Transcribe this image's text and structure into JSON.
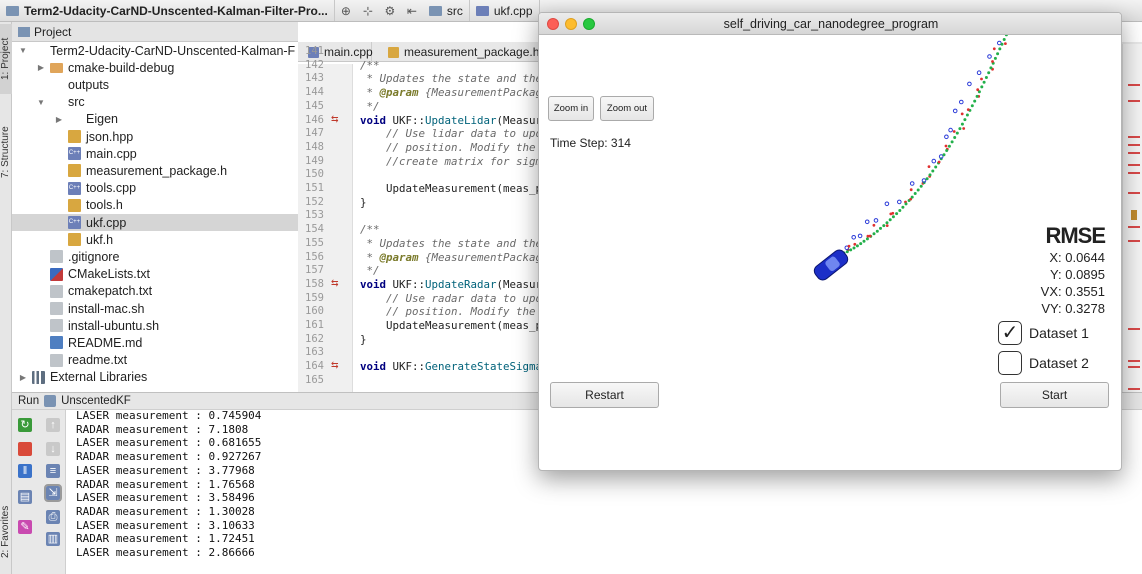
{
  "topbar": {
    "project_root": "Term2-Udacity-CarND-Unscented-Kalman-Filter-Pro...",
    "crumb_src": "src",
    "crumb_file": "ukf.cpp"
  },
  "side_tabs": {
    "project": "1: Project",
    "structure": "7: Structure",
    "favorites": "2: Favorites"
  },
  "project_panel": {
    "title": "Project",
    "items": [
      {
        "label": "Term2-Udacity-CarND-Unscented-Kalman-F",
        "kind": "folder",
        "twisty": "▼"
      },
      {
        "label": "cmake-build-debug",
        "kind": "foldo",
        "twisty": "▶"
      },
      {
        "label": "outputs",
        "kind": "folder",
        "twisty": ""
      },
      {
        "label": "src",
        "kind": "folder",
        "twisty": "▼"
      },
      {
        "label": "Eigen",
        "kind": "folder",
        "twisty": "▶"
      },
      {
        "label": "json.hpp",
        "kind": "h",
        "twisty": ""
      },
      {
        "label": "main.cpp",
        "kind": "cpp",
        "twisty": ""
      },
      {
        "label": "measurement_package.h",
        "kind": "h",
        "twisty": ""
      },
      {
        "label": "tools.cpp",
        "kind": "cpp",
        "twisty": ""
      },
      {
        "label": "tools.h",
        "kind": "h",
        "twisty": ""
      },
      {
        "label": "ukf.cpp",
        "kind": "cpp",
        "twisty": "",
        "selected": true
      },
      {
        "label": "ukf.h",
        "kind": "h",
        "twisty": ""
      },
      {
        "label": ".gitignore",
        "kind": "txt",
        "twisty": ""
      },
      {
        "label": "CMakeLists.txt",
        "kind": "cm",
        "twisty": ""
      },
      {
        "label": "cmakepatch.txt",
        "kind": "txt",
        "twisty": ""
      },
      {
        "label": "install-mac.sh",
        "kind": "txt",
        "twisty": ""
      },
      {
        "label": "install-ubuntu.sh",
        "kind": "txt",
        "twisty": ""
      },
      {
        "label": "README.md",
        "kind": "md",
        "twisty": ""
      },
      {
        "label": "readme.txt",
        "kind": "txt",
        "twisty": ""
      },
      {
        "label": "External Libraries",
        "kind": "lib",
        "twisty": "▶"
      }
    ]
  },
  "editor": {
    "tabs": [
      "main.cpp",
      "measurement_package.h"
    ],
    "lines": [
      {
        "n": "141",
        "html": ""
      },
      {
        "n": "142",
        "html": "<span>/**</span>",
        "c": true
      },
      {
        "n": "143",
        "html": " * Updates the state and the",
        "c": true
      },
      {
        "n": "144",
        "html": " * <span class=\"tg\">@param</span> {MeasurementPackage",
        "c": true
      },
      {
        "n": "145",
        "html": " */",
        "c": true
      },
      {
        "n": "146",
        "html": "<span class=\"kw\">void</span> UKF::<span class=\"fn\">UpdateLidar</span>(Measur",
        "g": true
      },
      {
        "n": "147",
        "html": "    // Use lidar data to upd",
        "c": true
      },
      {
        "n": "148",
        "html": "    // position. Modify the",
        "c": true
      },
      {
        "n": "149",
        "html": "    //create matrix for sigm",
        "c": true
      },
      {
        "n": "150",
        "html": ""
      },
      {
        "n": "151",
        "html": "    UpdateMeasurement(meas_p"
      },
      {
        "n": "152",
        "html": "}"
      },
      {
        "n": "153",
        "html": ""
      },
      {
        "n": "154",
        "html": "/**",
        "c": true
      },
      {
        "n": "155",
        "html": " * Updates the state and the",
        "c": true
      },
      {
        "n": "156",
        "html": " * <span class=\"tg\">@param</span> {MeasurementPackage",
        "c": true
      },
      {
        "n": "157",
        "html": " */",
        "c": true
      },
      {
        "n": "158",
        "html": "<span class=\"kw\">void</span> UKF::<span class=\"fn\">UpdateRadar</span>(Measur",
        "g": true
      },
      {
        "n": "159",
        "html": "    // Use radar data to upd",
        "c": true
      },
      {
        "n": "160",
        "html": "    // position. Modify the",
        "c": true
      },
      {
        "n": "161",
        "html": "    UpdateMeasurement(meas_p"
      },
      {
        "n": "162",
        "html": "}"
      },
      {
        "n": "163",
        "html": ""
      },
      {
        "n": "164",
        "html": "<span class=\"kw\">void</span> UKF::<span class=\"fn\">GenerateStateSigma</span>",
        "g": true
      },
      {
        "n": "165",
        "html": ""
      }
    ]
  },
  "run_panel": {
    "label": "Run",
    "config": "UnscentedKF",
    "lines": [
      "LASER measurement : 0.745904",
      "RADAR measurement : 7.1808",
      "LASER measurement : 0.681655",
      "RADAR measurement : 0.927267",
      "LASER measurement : 3.77968",
      "RADAR measurement : 1.76568",
      "LASER measurement : 3.58496",
      "RADAR measurement : 1.30028",
      "LASER measurement : 3.10633",
      "RADAR measurement : 1.72451",
      "LASER measurement : 2.86666"
    ]
  },
  "simulator": {
    "title": "self_driving_car_nanodegree_program",
    "zoom_in": "Zoom in",
    "zoom_out": "Zoom out",
    "time_step": "Time Step: 314",
    "rmse": {
      "title": "RMSE",
      "x": "X: 0.0644",
      "y": "Y: 0.0895",
      "vx": "VX: 0.3551",
      "vy": "VY: 0.3278"
    },
    "dataset1": "Dataset 1",
    "dataset1_checked": true,
    "dataset2": "Dataset 2",
    "dataset2_checked": false,
    "restart": "Restart",
    "start": "Start",
    "colors": {
      "lidar": "#e03030",
      "radar": "#2a3ad8",
      "estimate": "#22b04a",
      "car": "#1c2fc8"
    }
  }
}
